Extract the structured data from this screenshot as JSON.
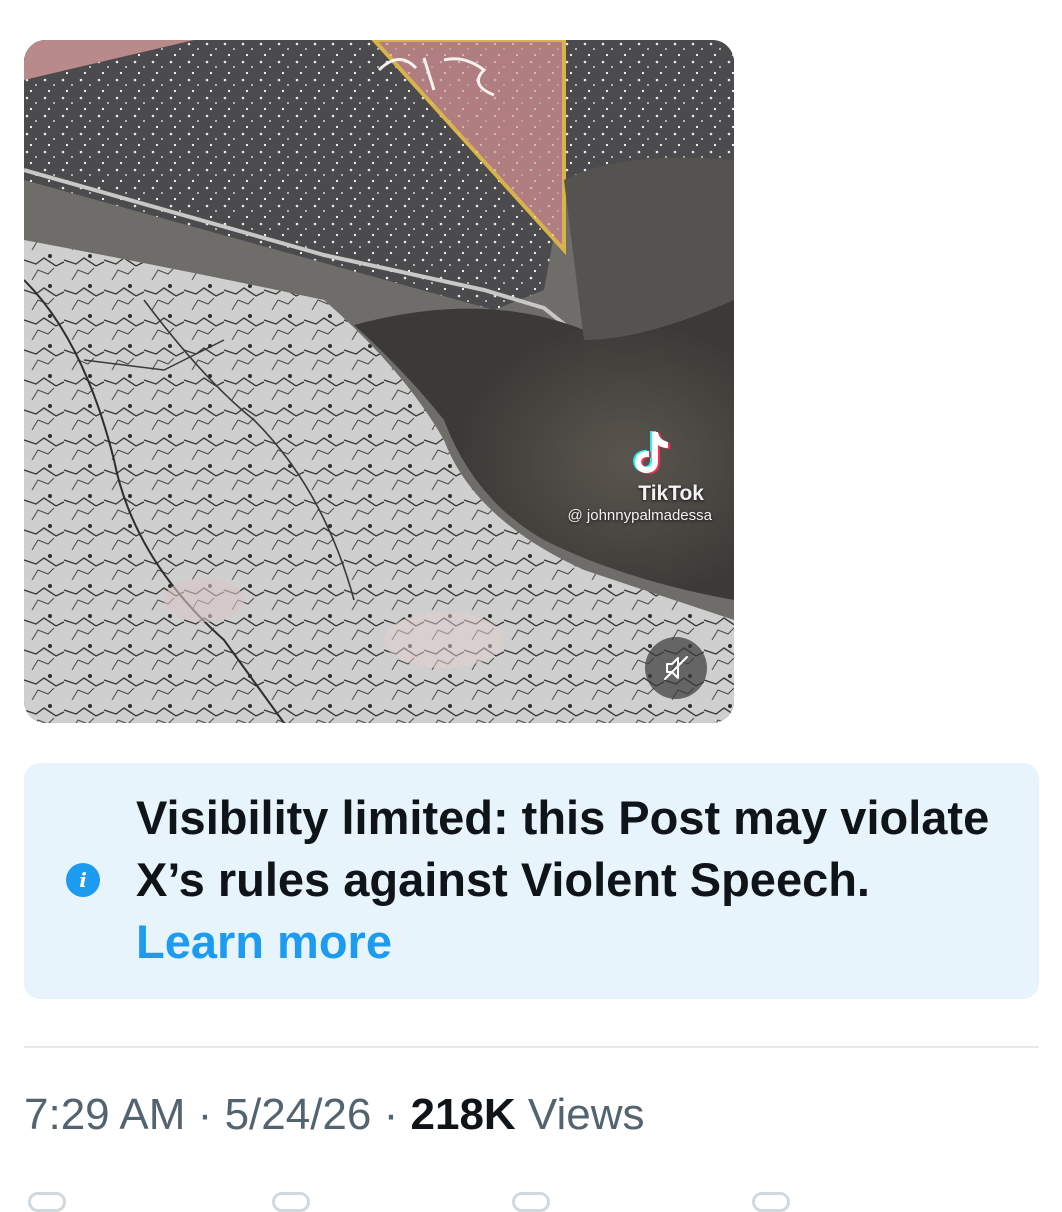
{
  "media": {
    "watermark_brand": "TikTok",
    "watermark_user": "@ johnnypalmadessa",
    "mute_icon": "speaker-muted-icon",
    "star_scrawl": "ICE"
  },
  "notice": {
    "icon": "info-icon",
    "text": "Visibility limited: this Post may violate X’s rules against Violent Speech.",
    "link_label": "Learn more",
    "background_color": "#e8f4fc",
    "link_color": "#1d9bf0"
  },
  "meta": {
    "time": "7:29 AM",
    "separator": "·",
    "date": "5/24/26",
    "views_count": "218K",
    "views_label": "Views"
  }
}
